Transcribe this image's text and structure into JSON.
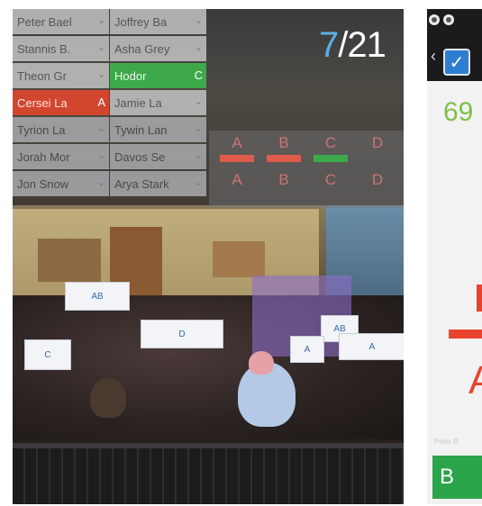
{
  "students": [
    [
      {
        "name": "Peter Bael",
        "state": "default"
      },
      {
        "name": "Joffrey Ba",
        "state": "default"
      }
    ],
    [
      {
        "name": "Stannis B.",
        "state": "default"
      },
      {
        "name": "Asha Grey",
        "state": "default"
      }
    ],
    [
      {
        "name": "Theon Gr",
        "state": "default"
      },
      {
        "name": "Hodor",
        "state": "green",
        "answer": "C"
      }
    ],
    [
      {
        "name": "Cersei La",
        "state": "red",
        "answer": "A"
      },
      {
        "name": "Jamie La",
        "state": "default"
      }
    ],
    [
      {
        "name": "Tyrion La",
        "state": "dark"
      },
      {
        "name": "Tywin Lan",
        "state": "dark"
      }
    ],
    [
      {
        "name": "Jorah Mor",
        "state": "dark"
      },
      {
        "name": "Davos Se",
        "state": "dark"
      }
    ],
    [
      {
        "name": "Jon Snow",
        "state": "dark"
      },
      {
        "name": "Arya Stark",
        "state": "dark"
      }
    ]
  ],
  "counter": {
    "current": "7",
    "total": "/21"
  },
  "score_columns": [
    {
      "top": "A",
      "bottom": "A",
      "bar_color": "#e05a4a",
      "filled": true
    },
    {
      "top": "B",
      "bottom": "B",
      "bar_color": "#e05a4a",
      "filled": true
    },
    {
      "top": "C",
      "bottom": "C",
      "bar_color": "#3da94a",
      "filled": true
    },
    {
      "top": "D",
      "bottom": "D",
      "bar_color": "#e05a4a",
      "filled": false
    }
  ],
  "cards": [
    "AB",
    "C",
    "D",
    "AB",
    "A",
    "A"
  ],
  "right": {
    "percent": "69",
    "big_letter": "A",
    "student_name": "Peter B",
    "answer_button": "B"
  }
}
